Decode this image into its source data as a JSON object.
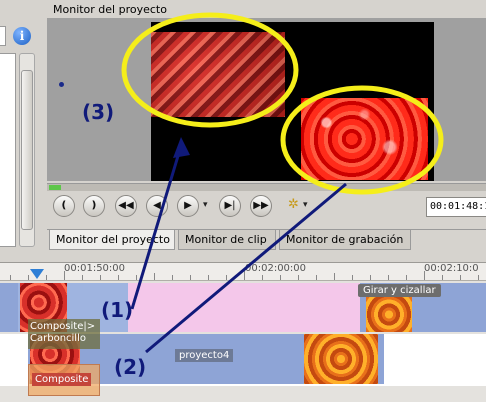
{
  "monitor": {
    "title": "Monitor del proyecto",
    "timecode": "00:01:48:1"
  },
  "tabs": [
    {
      "label": "Monitor del proyecto",
      "active": true
    },
    {
      "label": "Monitor de clip",
      "active": false
    },
    {
      "label": "Monitor de grabación",
      "active": false
    }
  ],
  "controls": [
    {
      "icon": "zone-start-icon"
    },
    {
      "icon": "zone-end-icon"
    },
    {
      "icon": "rewind-icon"
    },
    {
      "icon": "step-back-icon"
    },
    {
      "icon": "play-icon"
    },
    {
      "icon": "step-forward-icon"
    },
    {
      "icon": "fast-forward-icon"
    },
    {
      "icon": "wrench-icon"
    }
  ],
  "left_panel": {
    "info_glyph": "i"
  },
  "timeline": {
    "ruler": [
      "00:01:50:00",
      "00:02:00:00",
      "00:02:10:0"
    ],
    "track1": {
      "effect_label": "Girar y cizallar"
    },
    "track2": {
      "clip_label": "proyecto4"
    },
    "transitions": {
      "composite_top": "Composite|>",
      "composite_top_sub": "Carboncillo",
      "composite_bottom": "Composite"
    }
  },
  "annotations": {
    "label_1": "(1)",
    "label_2": "(2)",
    "label_3": "(3)",
    "color": "#101a7a",
    "ellipse_color": "#f5ee1a"
  }
}
